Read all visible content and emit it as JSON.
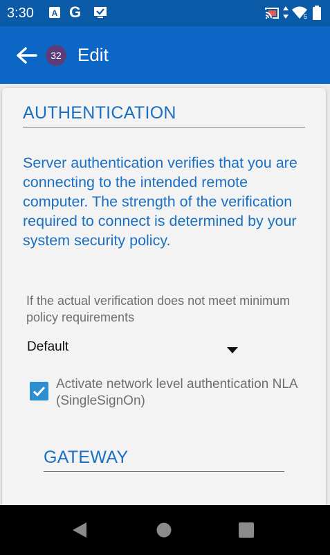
{
  "status_bar": {
    "time": "3:30",
    "left_icons": [
      "a-box-icon",
      "google-g-icon",
      "clipboard-check-icon"
    ],
    "right_icons": [
      "cast-icon",
      "data-arrows-icon",
      "wifi-icon",
      "battery-icon"
    ],
    "google_letter": "G",
    "a_letter": "A",
    "wifi_badge": "5"
  },
  "app_bar": {
    "back_icon": "arrow-left-icon",
    "badge": "32",
    "title": "Edit",
    "background": "#0c66c6"
  },
  "authentication": {
    "title": "AUTHENTICATION",
    "description": "Server authentication verifies that you are connecting to the intended remote computer. The strength of the verification required to connect is determined by your system security policy.",
    "policy_label": "If the actual verification does not meet minimum policy requirements",
    "dropdown_value": "Default",
    "nla_checked": true,
    "nla_label": "Activate network level authentication NLA (SingleSignOn)"
  },
  "gateway": {
    "title": "GATEWAY"
  },
  "nav_bar": {
    "icons": [
      "back-triangle-icon",
      "home-circle-icon",
      "recents-square-icon"
    ]
  },
  "colors": {
    "accent": "#1a6fc2",
    "status_bar": "#0a5aa8",
    "checkbox": "#2d8fd1"
  }
}
